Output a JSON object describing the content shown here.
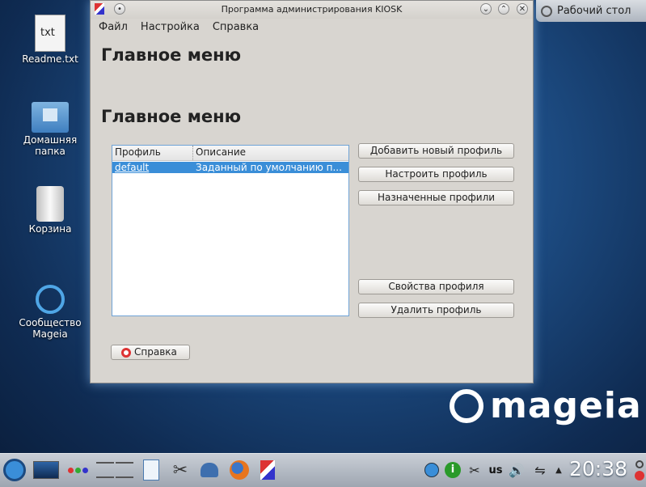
{
  "desktop": {
    "icons": [
      {
        "label": "Readme.txt",
        "glyph": "txt"
      },
      {
        "label": "Домашняя папка"
      },
      {
        "label": "Корзина"
      },
      {
        "label": "Сообщество Mageia"
      }
    ],
    "toolbox_label": "Рабочий стол",
    "brand": "mageia"
  },
  "window": {
    "title": "Программа администрирования KIOSK",
    "menu": [
      "Файл",
      "Настройка",
      "Справка"
    ],
    "heading1": "Главное меню",
    "heading2": "Главное меню",
    "list": {
      "columns": [
        "Профиль",
        "Описание"
      ],
      "rows": [
        {
          "profile": "default",
          "description": "Заданный по умолчанию п..."
        }
      ]
    },
    "buttons": {
      "add": "Добавить новый профиль",
      "configure": "Настроить профиль",
      "assigned": "Назначенные профили",
      "properties": "Свойства профиля",
      "delete": "Удалить профиль",
      "help": "Справка"
    }
  },
  "taskbar": {
    "keyboard_layout": "us",
    "clock": "20:38"
  },
  "colors": {
    "selection": "#3a8ed8",
    "window_bg": "#d8d5d0",
    "desktop": "#1c4a80"
  }
}
